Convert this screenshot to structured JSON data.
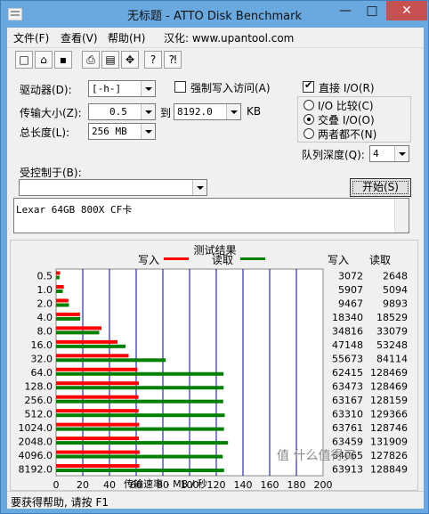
{
  "window": {
    "title": "无标题 - ATTO Disk Benchmark"
  },
  "menu": {
    "file": "文件(F)",
    "view": "查看(V)",
    "help": "帮助(H)",
    "credit": "汉化: www.upantool.com"
  },
  "titlebar_buttons": {
    "minimize": "—",
    "maximize": "□",
    "close": "✕"
  },
  "toolbar": {
    "new": "□",
    "open": "⌂",
    "save": "▪",
    "print": "⎙",
    "preview": "▤",
    "move": "✥",
    "help": "?",
    "context_help": "⁈"
  },
  "drive": {
    "label": "驱动器(D):",
    "value": "[-h-]"
  },
  "force_write": {
    "label": "强制写入访问(A)",
    "checked": false
  },
  "direct_io": {
    "label": "直接 I/O(R)",
    "checked": true
  },
  "transfer": {
    "label": "传输大小(Z):",
    "from": "0.5",
    "to_label": "到",
    "to": "8192.0",
    "unit": "KB"
  },
  "length": {
    "label": "总长度(L):",
    "value": "256 MB"
  },
  "io_mode": {
    "options": [
      "I/O 比较(C)",
      "交叠 I/O(O)",
      "两者都不(N)"
    ],
    "selected": 1
  },
  "queue": {
    "label": "队列深度(Q):",
    "value": "4"
  },
  "controlled": {
    "label": "受控制于(B):",
    "value": ""
  },
  "start_button": "开始(S)",
  "description": "Lexar 64GB 800X CF卡",
  "results": {
    "title": "测试结果",
    "legend_write": "写入",
    "legend_read": "读取",
    "col_write": "写入",
    "col_read": "读取",
    "write_color": "#ff0000",
    "read_color": "#008000"
  },
  "status": "要获得帮助, 请按 F1",
  "watermark": "值 什么值得买",
  "chart_data": {
    "type": "bar",
    "orientation": "horizontal",
    "xlabel": "传输速率 - MB / 秒",
    "xlim": [
      0,
      200
    ],
    "xticks": [
      0,
      20,
      40,
      60,
      80,
      100,
      120,
      140,
      160,
      180,
      200
    ],
    "categories": [
      "0.5",
      "1.0",
      "2.0",
      "4.0",
      "8.0",
      "16.0",
      "32.0",
      "64.0",
      "128.0",
      "256.0",
      "512.0",
      "1024.0",
      "2048.0",
      "4096.0",
      "8192.0"
    ],
    "series": [
      {
        "name": "写入",
        "values": [
          3072,
          5907,
          9467,
          18340,
          34816,
          47148,
          55673,
          62415,
          63473,
          63167,
          63310,
          63761,
          63459,
          64065,
          63913
        ]
      },
      {
        "name": "读取",
        "values": [
          2648,
          5094,
          9893,
          18529,
          33079,
          53248,
          84114,
          128469,
          128469,
          128159,
          129366,
          128746,
          131909,
          127826,
          128849
        ]
      }
    ]
  }
}
